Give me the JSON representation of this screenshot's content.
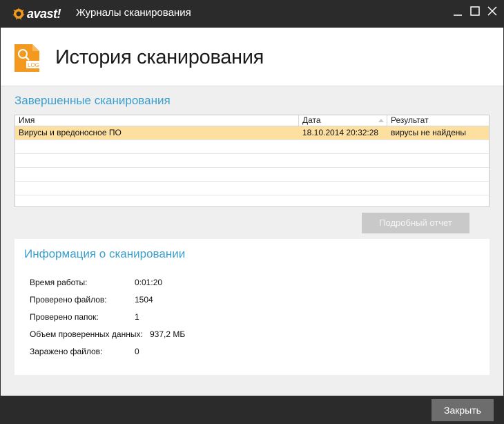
{
  "window": {
    "brand": "avast!",
    "title": "Журналы сканирования",
    "controls": [
      "minimize-icon",
      "maximize-icon",
      "close-icon"
    ]
  },
  "header": {
    "icon": "log-file-icon",
    "icon_badge": "LOG",
    "title": "История сканирования"
  },
  "completed": {
    "title": "Завершенные сканирования",
    "columns": [
      "Имя",
      "Дата",
      "Результат"
    ],
    "rows": [
      {
        "name": "Вирусы и вредоносное ПО",
        "date": "18.10.2014 20:32:28",
        "result": "вирусы не найдены"
      }
    ],
    "detail_button": "Подробный отчет"
  },
  "info": {
    "title": "Информация о сканировании",
    "rows": [
      {
        "label": "Время работы:",
        "value": "0:01:20"
      },
      {
        "label": "Проверено файлов:",
        "value": "1504"
      },
      {
        "label": "Проверено папок:",
        "value": "1"
      },
      {
        "label": "Объем проверенных данных:",
        "value": "937,2 МБ"
      },
      {
        "label": "Заражено файлов:",
        "value": "0"
      }
    ]
  },
  "footer": {
    "close_button": "Закрыть"
  },
  "colors": {
    "accent": "#3a9fcc",
    "brand_orange": "#f39a1e",
    "selected_row": "#fddfa0",
    "titlebar": "#2b2b2b"
  }
}
